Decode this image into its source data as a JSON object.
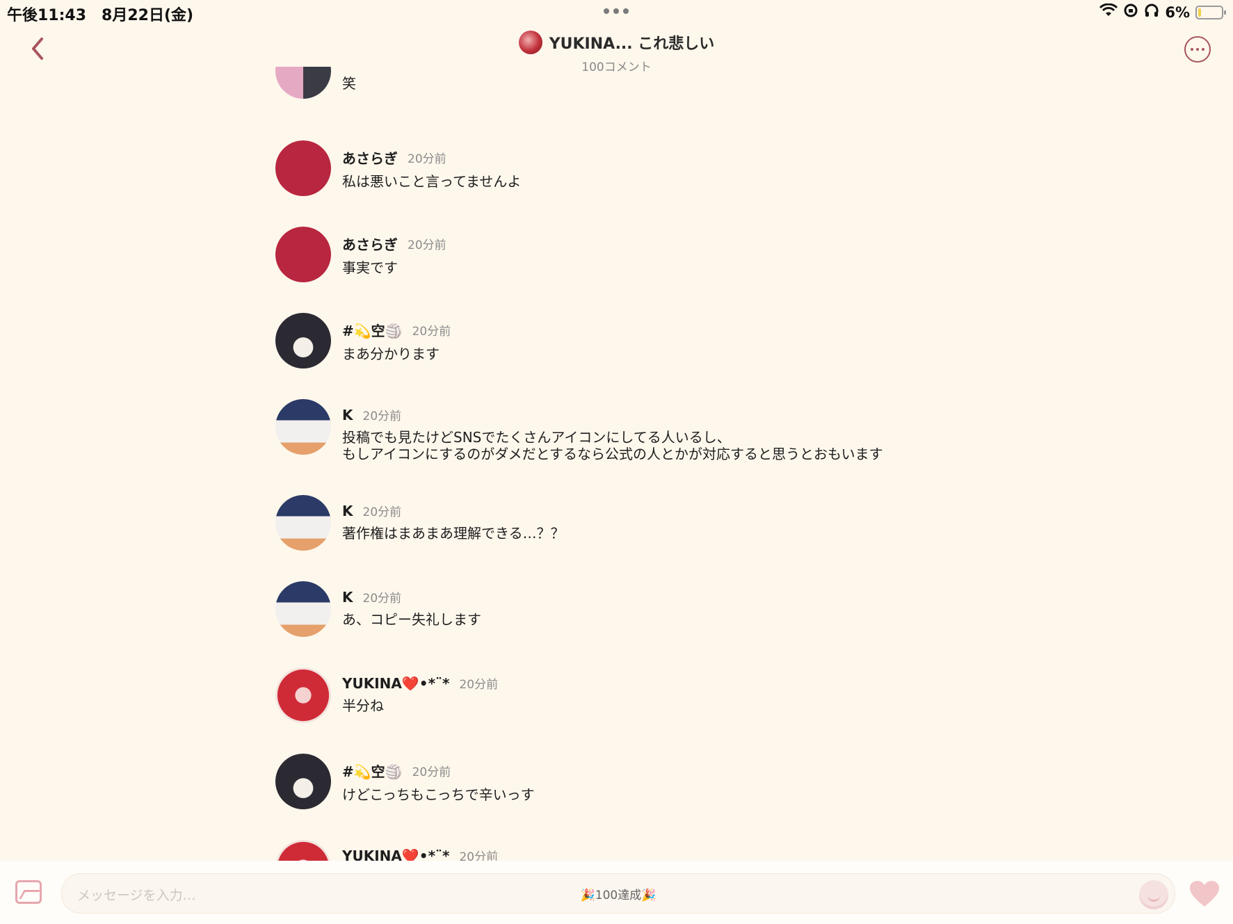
{
  "status_bar": {
    "time": "午後11:43　8月22日(金)",
    "battery": "6%"
  },
  "header": {
    "title": "YUKINA... これ悲しい",
    "subtitle": "100コメント"
  },
  "messages": [
    {
      "name": "",
      "time": "",
      "text": "笑"
    },
    {
      "name": "あさらぎ",
      "time": "20分前",
      "text": "私は悪いこと言ってませんよ"
    },
    {
      "name": "あさらぎ",
      "time": "20分前",
      "text": "事実です"
    },
    {
      "name": "#💫空🏐",
      "time": "20分前",
      "text": "まあ分かります"
    },
    {
      "name": "K",
      "time": "20分前",
      "text": "投稿でも見たけどSNSでたくさんアイコンにしてる人いるし、",
      "text2": "もしアイコンにするのがダメだとするなら公式の人とかが対応すると思うとおもいます"
    },
    {
      "name": "K",
      "time": "20分前",
      "text": "著作権はまあまあ理解できる…？？"
    },
    {
      "name": "K",
      "time": "20分前",
      "text": "あ、コピー失礼します"
    },
    {
      "name": "YUKINA❤️•*¨*",
      "time": "20分前",
      "text": "半分ね"
    },
    {
      "name": "#💫空🏐",
      "time": "20分前",
      "text": "けどこっちもこっちで辛いっす"
    },
    {
      "name": "YUKINA❤️•*¨*",
      "time": "20分前",
      "text": ""
    }
  ],
  "composer": {
    "placeholder": "メッセージを入力…",
    "center_label": "🎉100達成🎉"
  },
  "icons": {
    "back": "chevron-left-icon",
    "more": "more-horizontal-icon",
    "image": "image-icon",
    "emoji": "emoji-icon",
    "heart": "heart-icon",
    "wifi": "wifi-icon",
    "headphones": "headphones-icon"
  },
  "colors": {
    "background": "#FEF7EC",
    "accent": "#A8545C",
    "avatar_red": "#B8263F"
  }
}
